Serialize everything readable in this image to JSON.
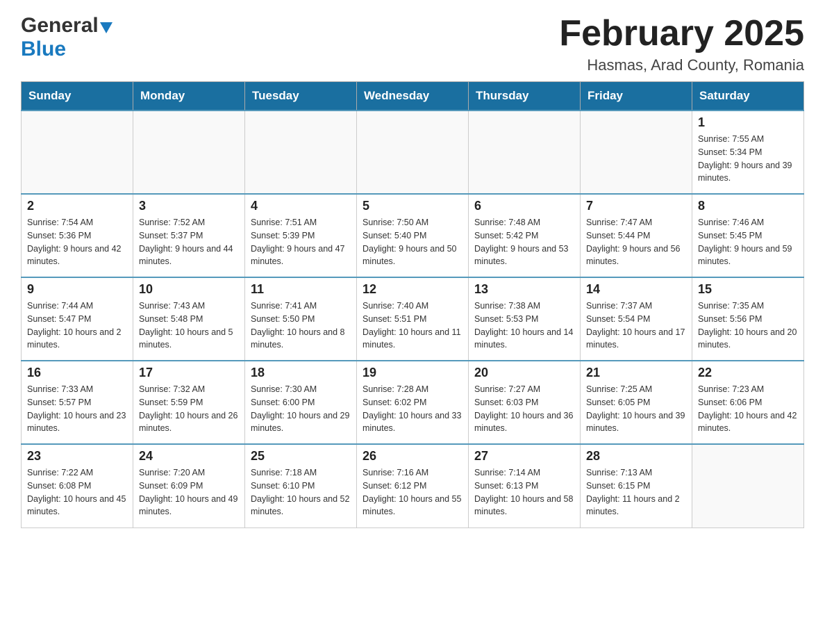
{
  "header": {
    "logo_general": "General",
    "logo_blue": "Blue",
    "month_title": "February 2025",
    "location": "Hasmas, Arad County, Romania"
  },
  "days_of_week": [
    "Sunday",
    "Monday",
    "Tuesday",
    "Wednesday",
    "Thursday",
    "Friday",
    "Saturday"
  ],
  "weeks": [
    [
      {
        "day": "",
        "info": ""
      },
      {
        "day": "",
        "info": ""
      },
      {
        "day": "",
        "info": ""
      },
      {
        "day": "",
        "info": ""
      },
      {
        "day": "",
        "info": ""
      },
      {
        "day": "",
        "info": ""
      },
      {
        "day": "1",
        "info": "Sunrise: 7:55 AM\nSunset: 5:34 PM\nDaylight: 9 hours and 39 minutes."
      }
    ],
    [
      {
        "day": "2",
        "info": "Sunrise: 7:54 AM\nSunset: 5:36 PM\nDaylight: 9 hours and 42 minutes."
      },
      {
        "day": "3",
        "info": "Sunrise: 7:52 AM\nSunset: 5:37 PM\nDaylight: 9 hours and 44 minutes."
      },
      {
        "day": "4",
        "info": "Sunrise: 7:51 AM\nSunset: 5:39 PM\nDaylight: 9 hours and 47 minutes."
      },
      {
        "day": "5",
        "info": "Sunrise: 7:50 AM\nSunset: 5:40 PM\nDaylight: 9 hours and 50 minutes."
      },
      {
        "day": "6",
        "info": "Sunrise: 7:48 AM\nSunset: 5:42 PM\nDaylight: 9 hours and 53 minutes."
      },
      {
        "day": "7",
        "info": "Sunrise: 7:47 AM\nSunset: 5:44 PM\nDaylight: 9 hours and 56 minutes."
      },
      {
        "day": "8",
        "info": "Sunrise: 7:46 AM\nSunset: 5:45 PM\nDaylight: 9 hours and 59 minutes."
      }
    ],
    [
      {
        "day": "9",
        "info": "Sunrise: 7:44 AM\nSunset: 5:47 PM\nDaylight: 10 hours and 2 minutes."
      },
      {
        "day": "10",
        "info": "Sunrise: 7:43 AM\nSunset: 5:48 PM\nDaylight: 10 hours and 5 minutes."
      },
      {
        "day": "11",
        "info": "Sunrise: 7:41 AM\nSunset: 5:50 PM\nDaylight: 10 hours and 8 minutes."
      },
      {
        "day": "12",
        "info": "Sunrise: 7:40 AM\nSunset: 5:51 PM\nDaylight: 10 hours and 11 minutes."
      },
      {
        "day": "13",
        "info": "Sunrise: 7:38 AM\nSunset: 5:53 PM\nDaylight: 10 hours and 14 minutes."
      },
      {
        "day": "14",
        "info": "Sunrise: 7:37 AM\nSunset: 5:54 PM\nDaylight: 10 hours and 17 minutes."
      },
      {
        "day": "15",
        "info": "Sunrise: 7:35 AM\nSunset: 5:56 PM\nDaylight: 10 hours and 20 minutes."
      }
    ],
    [
      {
        "day": "16",
        "info": "Sunrise: 7:33 AM\nSunset: 5:57 PM\nDaylight: 10 hours and 23 minutes."
      },
      {
        "day": "17",
        "info": "Sunrise: 7:32 AM\nSunset: 5:59 PM\nDaylight: 10 hours and 26 minutes."
      },
      {
        "day": "18",
        "info": "Sunrise: 7:30 AM\nSunset: 6:00 PM\nDaylight: 10 hours and 29 minutes."
      },
      {
        "day": "19",
        "info": "Sunrise: 7:28 AM\nSunset: 6:02 PM\nDaylight: 10 hours and 33 minutes."
      },
      {
        "day": "20",
        "info": "Sunrise: 7:27 AM\nSunset: 6:03 PM\nDaylight: 10 hours and 36 minutes."
      },
      {
        "day": "21",
        "info": "Sunrise: 7:25 AM\nSunset: 6:05 PM\nDaylight: 10 hours and 39 minutes."
      },
      {
        "day": "22",
        "info": "Sunrise: 7:23 AM\nSunset: 6:06 PM\nDaylight: 10 hours and 42 minutes."
      }
    ],
    [
      {
        "day": "23",
        "info": "Sunrise: 7:22 AM\nSunset: 6:08 PM\nDaylight: 10 hours and 45 minutes."
      },
      {
        "day": "24",
        "info": "Sunrise: 7:20 AM\nSunset: 6:09 PM\nDaylight: 10 hours and 49 minutes."
      },
      {
        "day": "25",
        "info": "Sunrise: 7:18 AM\nSunset: 6:10 PM\nDaylight: 10 hours and 52 minutes."
      },
      {
        "day": "26",
        "info": "Sunrise: 7:16 AM\nSunset: 6:12 PM\nDaylight: 10 hours and 55 minutes."
      },
      {
        "day": "27",
        "info": "Sunrise: 7:14 AM\nSunset: 6:13 PM\nDaylight: 10 hours and 58 minutes."
      },
      {
        "day": "28",
        "info": "Sunrise: 7:13 AM\nSunset: 6:15 PM\nDaylight: 11 hours and 2 minutes."
      },
      {
        "day": "",
        "info": ""
      }
    ]
  ]
}
